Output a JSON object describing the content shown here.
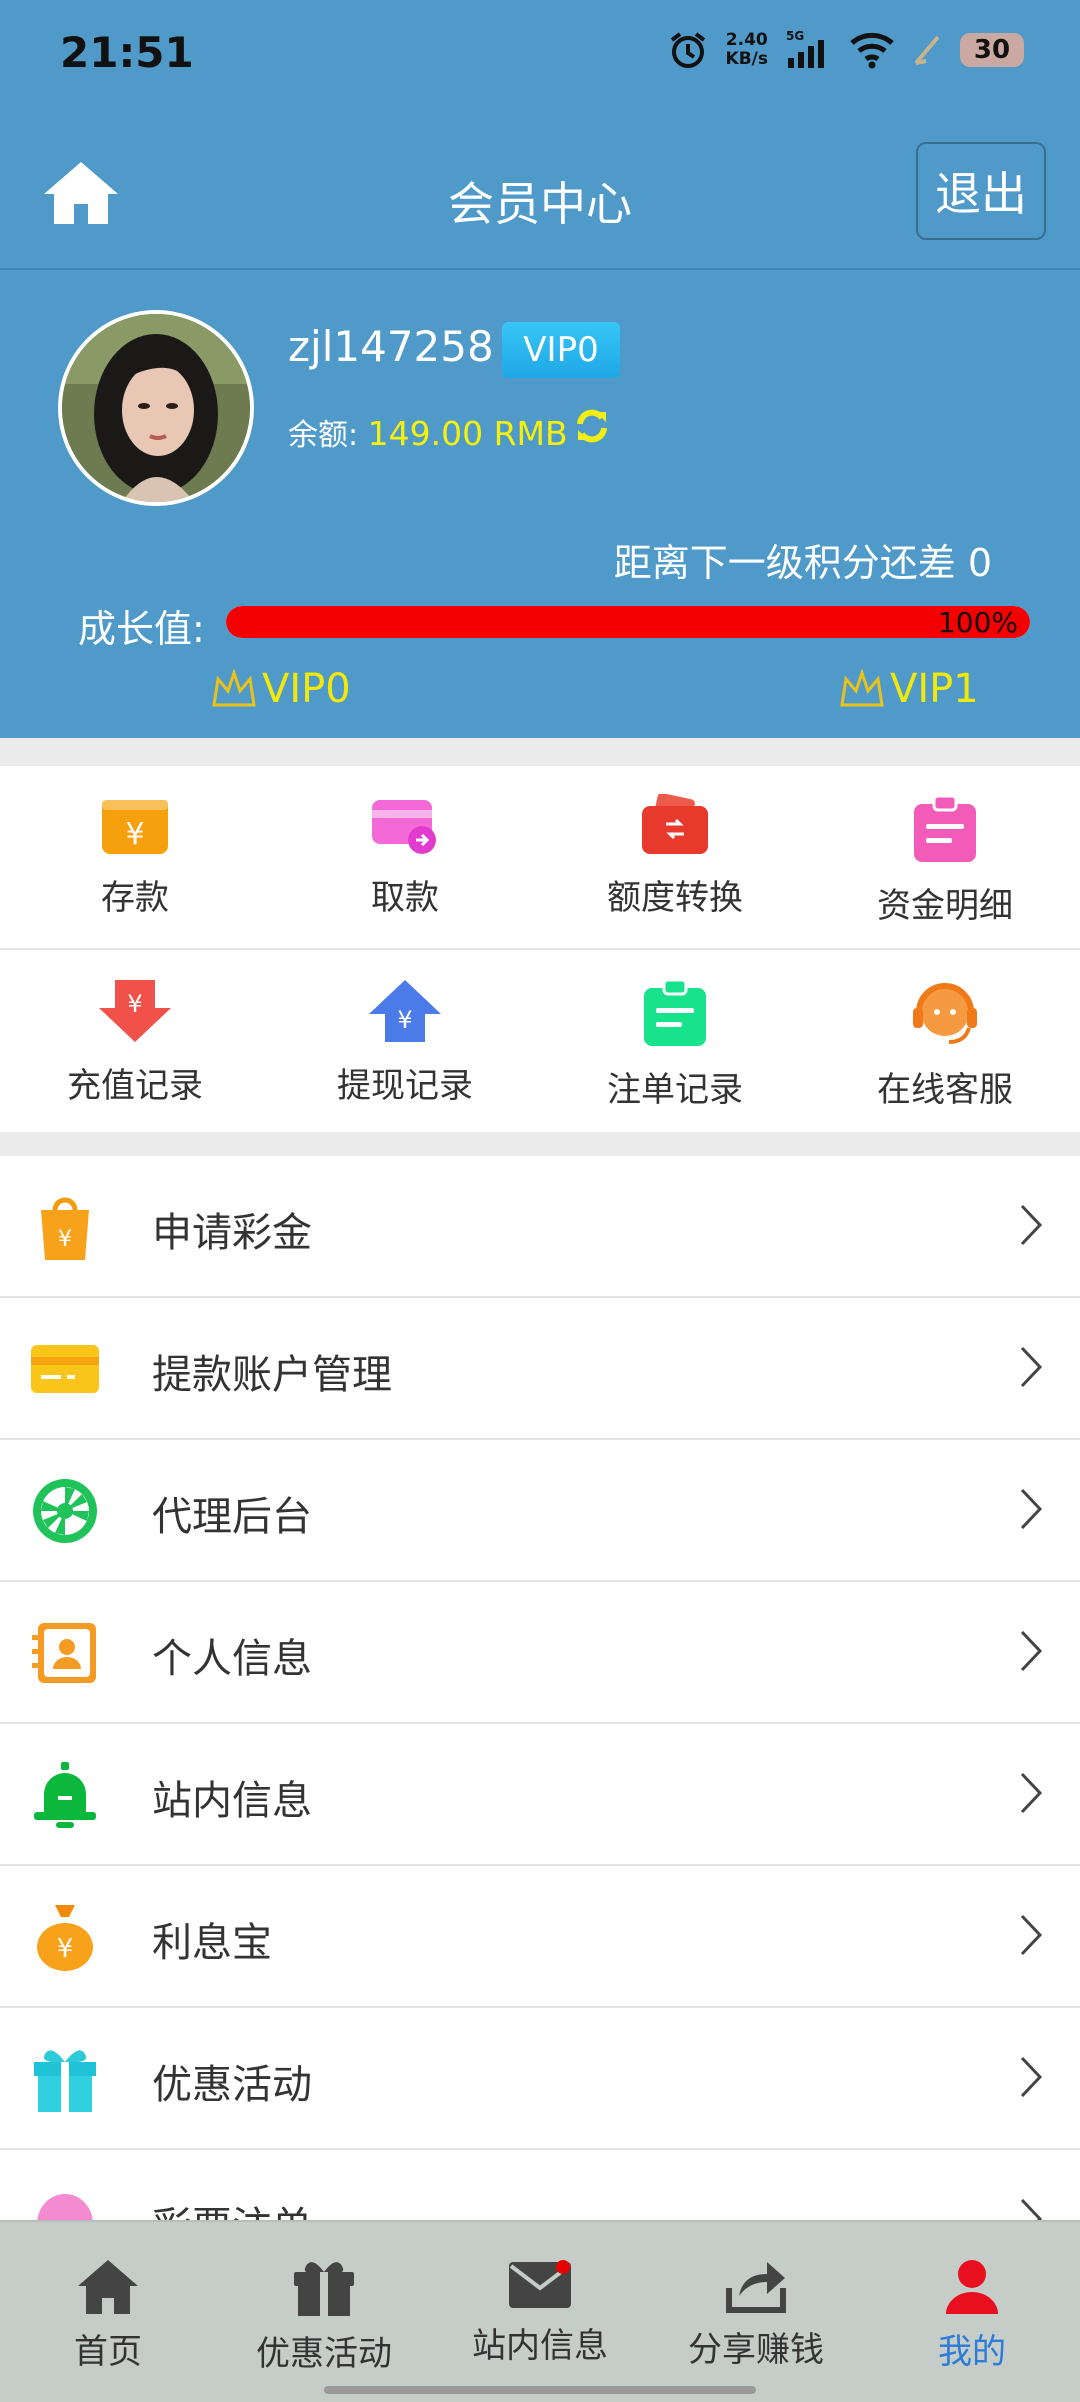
{
  "status": {
    "time": "21:51",
    "speed_top": "2.40",
    "speed_bottom": "KB/s",
    "net": "5G",
    "battery": "30"
  },
  "header": {
    "title": "会员中心",
    "logout_label": "退出"
  },
  "profile": {
    "username": "zjl147258",
    "vip_badge": "VIP0",
    "balance_label": "余额:",
    "balance_value": "149.00 RMB",
    "next_level_text": "距离下一级积分还差 0",
    "growth_label": "成长值:",
    "growth_progress": 100,
    "growth_percent_text": "100%",
    "current_level": "VIP0",
    "next_level": "VIP1"
  },
  "grid": [
    [
      {
        "label": "存款",
        "icon": "deposit-icon"
      },
      {
        "label": "取款",
        "icon": "withdraw-icon"
      },
      {
        "label": "额度转换",
        "icon": "transfer-icon"
      },
      {
        "label": "资金明细",
        "icon": "funds-detail-icon"
      }
    ],
    [
      {
        "label": "充值记录",
        "icon": "recharge-record-icon"
      },
      {
        "label": "提现记录",
        "icon": "withdraw-record-icon"
      },
      {
        "label": "注单记录",
        "icon": "bet-record-icon"
      },
      {
        "label": "在线客服",
        "icon": "customer-service-icon"
      }
    ]
  ],
  "menu": [
    {
      "label": "申请彩金",
      "icon": "shopping-bag-icon"
    },
    {
      "label": "提款账户管理",
      "icon": "bank-card-icon"
    },
    {
      "label": "代理后台",
      "icon": "wheel-icon"
    },
    {
      "label": "个人信息",
      "icon": "contact-book-icon"
    },
    {
      "label": "站内信息",
      "icon": "bell-icon"
    },
    {
      "label": "利息宝",
      "icon": "money-bag-icon"
    },
    {
      "label": "优惠活动",
      "icon": "gift-icon"
    },
    {
      "label": "彩票注单",
      "icon": "lottery-icon"
    }
  ],
  "tabs": [
    {
      "label": "首页",
      "icon": "home-icon"
    },
    {
      "label": "优惠活动",
      "icon": "gift-icon"
    },
    {
      "label": "站内信息",
      "icon": "mail-icon"
    },
    {
      "label": "分享赚钱",
      "icon": "share-icon"
    },
    {
      "label": "我的",
      "icon": "user-icon",
      "active": true
    }
  ],
  "colors": {
    "header": "#4f9ac9",
    "balance": "#f6f10c",
    "progress": "#f40000",
    "active_tab": "#2b7bd8"
  }
}
